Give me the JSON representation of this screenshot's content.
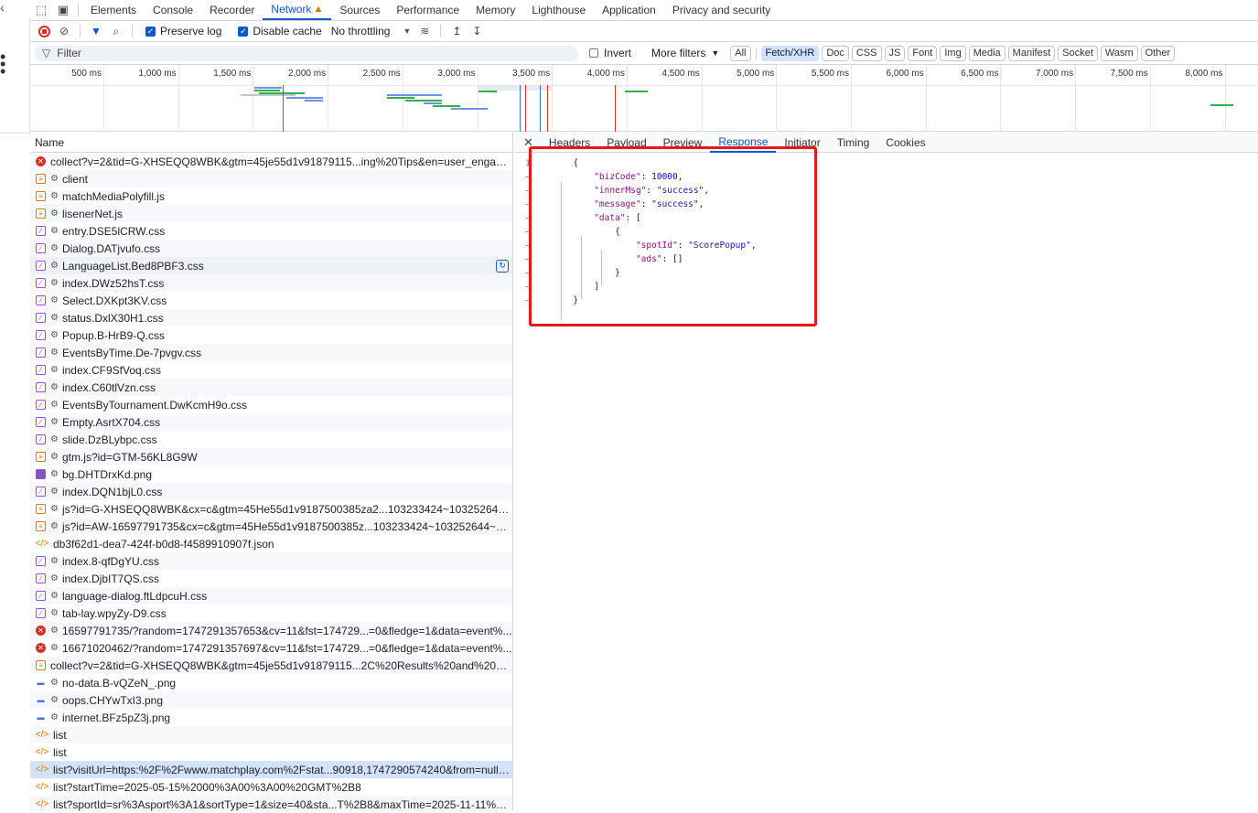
{
  "tabs": {
    "items": [
      "Elements",
      "Console",
      "Recorder",
      "Network",
      "Sources",
      "Performance",
      "Memory",
      "Lighthouse",
      "Application",
      "Privacy and security"
    ],
    "active": "Network"
  },
  "toolbar": {
    "preserve_log": "Preserve log",
    "disable_cache": "Disable cache",
    "throttling": "No throttling"
  },
  "filter": {
    "placeholder": "Filter",
    "invert": "Invert",
    "more_filters": "More filters",
    "chips": [
      "All",
      "Fetch/XHR",
      "Doc",
      "CSS",
      "JS",
      "Font",
      "Img",
      "Media",
      "Manifest",
      "Socket",
      "Wasm",
      "Other"
    ],
    "active_chip": "Fetch/XHR"
  },
  "timeline": {
    "labels": [
      "500 ms",
      "1,000 ms",
      "1,500 ms",
      "2,000 ms",
      "2,500 ms",
      "3,000 ms",
      "3,500 ms",
      "4,000 ms",
      "4,500 ms",
      "5,000 ms",
      "5,500 ms",
      "6,000 ms",
      "6,500 ms",
      "7,000 ms",
      "7,500 ms",
      "8,000 ms"
    ]
  },
  "list": {
    "header": "Name",
    "rows": [
      {
        "name": "collect?v=2&tid=G-XHSEQQ8WBK&gtm=45je55d1v91879115...ing%20Tips&en=user_engagem...",
        "icon": "error",
        "gear": false,
        "state": "error"
      },
      {
        "name": "client",
        "icon": "script",
        "gear": true
      },
      {
        "name": "matchMediaPolyfill.js",
        "icon": "script",
        "gear": true
      },
      {
        "name": "lisenerNet.js",
        "icon": "script",
        "gear": true
      },
      {
        "name": "entry.DSE5lCRW.css",
        "icon": "css",
        "gear": true
      },
      {
        "name": "Dialog.DATjvufo.css",
        "icon": "css",
        "gear": true
      },
      {
        "name": "LanguageList.Bed8PBF3.css",
        "icon": "css",
        "gear": true,
        "state": "hover"
      },
      {
        "name": "index.DWz52hsT.css",
        "icon": "css",
        "gear": true
      },
      {
        "name": "Select.DXKpt3KV.css",
        "icon": "css",
        "gear": true
      },
      {
        "name": "status.DxlX30H1.css",
        "icon": "css",
        "gear": true
      },
      {
        "name": "Popup.B-HrB9-Q.css",
        "icon": "css",
        "gear": true
      },
      {
        "name": "EventsByTime.De-7pvgv.css",
        "icon": "css",
        "gear": true
      },
      {
        "name": "index.CF9SfVoq.css",
        "icon": "css",
        "gear": true
      },
      {
        "name": "index.C60tlVzn.css",
        "icon": "css",
        "gear": true
      },
      {
        "name": "EventsByTournament.DwKcmH9o.css",
        "icon": "css",
        "gear": true
      },
      {
        "name": "Empty.AsrtX704.css",
        "icon": "css",
        "gear": true
      },
      {
        "name": "slide.DzBLybpc.css",
        "icon": "css",
        "gear": true
      },
      {
        "name": "gtm.js?id=GTM-56KL8G9W",
        "icon": "script",
        "gear": true
      },
      {
        "name": "bg.DHTDrxKd.png",
        "icon": "image",
        "gear": true
      },
      {
        "name": "index.DQN1bjL0.css",
        "icon": "css",
        "gear": true
      },
      {
        "name": "js?id=G-XHSEQQ8WBK&cx=c&gtm=45He55d1v9187500385za2...103233424~103252644~10...",
        "icon": "script",
        "gear": true
      },
      {
        "name": "js?id=AW-16597791735&cx=c&gtm=45He55d1v9187500385z...103233424~103252644~103...",
        "icon": "script",
        "gear": true
      },
      {
        "name": "db3f62d1-dea7-424f-b0d8-f4589910907f.json",
        "icon": "xhr",
        "gear": false
      },
      {
        "name": "index.8-qfDgYU.css",
        "icon": "css",
        "gear": true
      },
      {
        "name": "index.DjbIT7QS.css",
        "icon": "css",
        "gear": true
      },
      {
        "name": "language-dialog.ftLdpcuH.css",
        "icon": "css",
        "gear": true
      },
      {
        "name": "tab-lay.wpyZy-D9.css",
        "icon": "css",
        "gear": true
      },
      {
        "name": "16597791735/?random=1747291357653&cv=11&fst=174729...=0&fledge=1&data=event%...",
        "icon": "error",
        "gear": true,
        "state": "error"
      },
      {
        "name": "16671020462/?random=1747291357697&cv=11&fst=174729...=0&fledge=1&data=event%...",
        "icon": "error",
        "gear": true,
        "state": "error"
      },
      {
        "name": "collect?v=2&tid=G-XHSEQQ8WBK&gtm=45je55d1v91879115...2C%20Results%20and%20Betti...",
        "icon": "script",
        "gear": false
      },
      {
        "name": "no-data.B-vQZeN_.png",
        "icon": "png",
        "gear": true
      },
      {
        "name": "oops.CHYwTxI3.png",
        "icon": "png",
        "gear": true
      },
      {
        "name": "internet.BFz5pZ3j.png",
        "icon": "png",
        "gear": true
      },
      {
        "name": "list",
        "icon": "xhr",
        "gear": false
      },
      {
        "name": "list",
        "icon": "xhr",
        "gear": false
      },
      {
        "name": "list?visitUrl=https:%2F%2Fwww.matchplay.com%2Fstat...90918,1747290574240&from=null,null,...",
        "icon": "xhr",
        "gear": false,
        "state": "selected"
      },
      {
        "name": "list?startTime=2025-05-15%2000%3A00%3A00%20GMT%2B8",
        "icon": "xhr",
        "gear": false
      },
      {
        "name": "list?sportId=sr%3Asport%3A1&sortType=1&size=40&sta...T%2B8&maxTime=2025-11-11%200...",
        "icon": "xhr",
        "gear": false
      }
    ]
  },
  "detail": {
    "tabs": [
      "Headers",
      "Payload",
      "Preview",
      "Response",
      "Initiator",
      "Timing",
      "Cookies"
    ],
    "active": "Response",
    "line_number_first": "1",
    "line_number_rest": "–",
    "json": {
      "bizCode_key": "\"bizCode\"",
      "bizCode_val": "10000",
      "innerMsg_key": "\"innerMsg\"",
      "innerMsg_val": "\"success\"",
      "message_key": "\"message\"",
      "message_val": "\"success\"",
      "data_key": "\"data\"",
      "spotId_key": "\"spotId\"",
      "spotId_val": "\"ScorePopup\"",
      "ads_key": "\"ads\"",
      "ads_val": "[]"
    }
  },
  "colors": {
    "accent": "#0b57d0",
    "error": "#d93025",
    "highlight_box": "#e8181b"
  }
}
